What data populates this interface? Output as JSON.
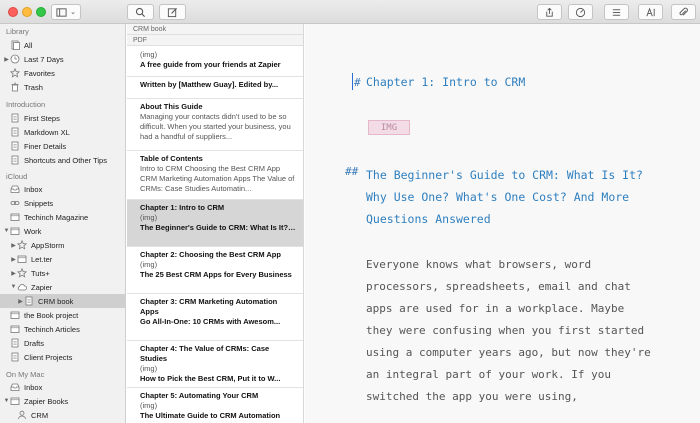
{
  "sidebar": {
    "sections": {
      "library": "Library",
      "introduction": "Introduction",
      "icloud": "iCloud",
      "on_my_mac": "On My Mac"
    },
    "items": [
      {
        "label": "All",
        "icon": "all-icon"
      },
      {
        "label": "Last 7 Days",
        "icon": "clock-icon"
      },
      {
        "label": "Favorites",
        "icon": "star-icon"
      },
      {
        "label": "Trash",
        "icon": "trash-icon"
      },
      {
        "label": "First Steps",
        "icon": "sheet-icon"
      },
      {
        "label": "Markdown XL",
        "icon": "sheet-icon"
      },
      {
        "label": "Finer Details",
        "icon": "sheet-icon"
      },
      {
        "label": "Shortcuts and Other Tips",
        "icon": "sheet-icon"
      },
      {
        "label": "Inbox",
        "icon": "inbox-icon"
      },
      {
        "label": "Snippets",
        "icon": "link-icon"
      },
      {
        "label": "Techinch Magazine",
        "icon": "folder-icon"
      },
      {
        "label": "Work",
        "icon": "folder-icon"
      },
      {
        "label": "AppStorm",
        "icon": "star-icon"
      },
      {
        "label": "Let.ter",
        "icon": "folder-icon"
      },
      {
        "label": "Tuts+",
        "icon": "star-icon"
      },
      {
        "label": "Zapier",
        "icon": "cloud-icon"
      },
      {
        "label": "CRM book",
        "icon": "sheet-icon"
      },
      {
        "label": "the Book project",
        "icon": "folder-icon"
      },
      {
        "label": "Techinch Articles",
        "icon": "folder-icon"
      },
      {
        "label": "Drafts",
        "icon": "sheet-icon"
      },
      {
        "label": "Client Projects",
        "icon": "sheet-icon"
      },
      {
        "label": "Inbox",
        "icon": "inbox-icon"
      },
      {
        "label": "Zapier Books",
        "icon": "folder-icon"
      },
      {
        "label": "CRM",
        "icon": "person-icon"
      }
    ]
  },
  "notelist": {
    "header": "CRM book",
    "subheader": "PDF",
    "notes": [
      {
        "lines": [
          "(img)",
          "A free guide from your friends at Zapier"
        ]
      },
      {
        "lines": [
          "Written by [Matthew Guay]. Edited by..."
        ]
      },
      {
        "lines": [
          "About This Guide",
          "Managing your contacts didn't used to be so difficult. When you started your business, you had a handful of suppliers..."
        ]
      },
      {
        "lines": [
          "Table of Contents",
          "Intro to CRM Choosing the Best CRM App CRM Marketing Automation Apps The Value of CRMs: Case Studies Automatin..."
        ]
      },
      {
        "lines": [
          "Chapter 1: Intro to CRM",
          "(img)",
          "The Beginner's Guide to CRM: What Is It? Why Use One? What's One Cost? A..."
        ]
      },
      {
        "lines": [
          "Chapter 2: Choosing the Best CRM App",
          "(img)",
          "The 25 Best CRM Apps for Every Business"
        ]
      },
      {
        "lines": [
          "Chapter 3: CRM Marketing Automation Apps",
          "Go All-In-One: 10 CRMs with Awesom..."
        ]
      },
      {
        "lines": [
          "Chapter 4: The Value of CRMs: Case Studies",
          "(img)",
          "How to Pick the Best CRM, Put it to W..."
        ]
      },
      {
        "lines": [
          "Chapter 5: Automating Your CRM",
          "(img)",
          "The Ultimate Guide to CRM Automation"
        ]
      }
    ]
  },
  "editor": {
    "h1_marker": "#",
    "h1": "Chapter 1: Intro to CRM",
    "img_tag": "IMG",
    "h2_marker": "##",
    "h2": "The Beginner's Guide to CRM: What Is It? Why Use One? What's One Cost? And More Questions Answered",
    "body": "Everyone knows what browsers, word processors, spreadsheets, email and chat apps are used for in a workplace. Maybe they were confusing when you first started using a computer years ago, but now they're an integral part of your work. If you switched the app you were using,"
  },
  "colors": {
    "heading": "#2f7fbf",
    "selection": "#cfcfcf",
    "editor_bg": "#f8f8f8"
  }
}
